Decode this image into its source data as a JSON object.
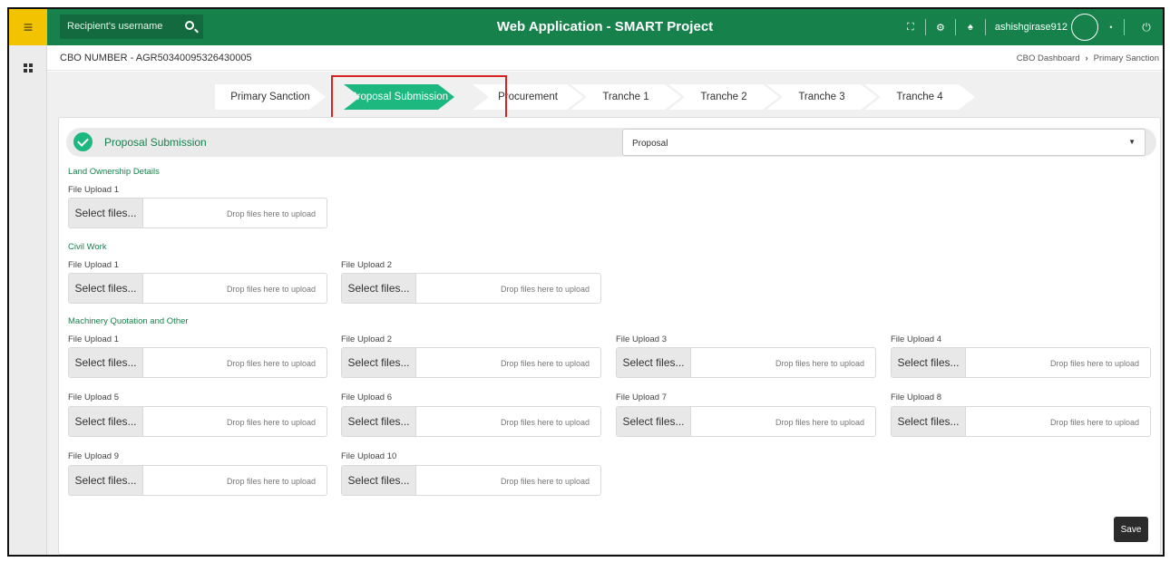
{
  "topbar": {
    "search_placeholder": "Recipient's username",
    "title": "Web Application - SMART Project",
    "username": "ashishgirase912"
  },
  "subheader": {
    "cbo_number": "CBO NUMBER - AGR50340095326430005",
    "breadcrumb": [
      "CBO Dashboard",
      "Primary Sanction"
    ]
  },
  "stepper": {
    "steps": [
      "Primary Sanction",
      "Proposal Submission",
      "Procurement",
      "Tranche 1",
      "Tranche 2",
      "Tranche 3",
      "Tranche 4"
    ],
    "active": "Proposal Submission"
  },
  "section": {
    "title": "Proposal Submission",
    "select_value": "Proposal"
  },
  "groups": {
    "land": "Land Ownership Details",
    "civil": "Civil Work",
    "machinery": "Machinery Quotation and Other"
  },
  "upload": {
    "button": "Select files...",
    "drop": "Drop files here to upload"
  },
  "labels": {
    "u1": "File Upload 1",
    "u2": "File Upload 2",
    "u3": "File Upload 3",
    "u4": "File Upload 4",
    "u5": "File Upload 5",
    "u6": "File Upload 6",
    "u7": "File Upload 7",
    "u8": "File Upload 8",
    "u9": "File Upload 9",
    "u10": "File Upload 10"
  },
  "save_label": "Save",
  "icons": [
    "menu-icon",
    "grid-icon",
    "search-icon",
    "fullscreen-icon",
    "settings-icon",
    "notification-icon",
    "caret-down-icon",
    "power-icon",
    "check-icon"
  ],
  "colors": {
    "brand_green": "#17814c",
    "active_step": "#1db880",
    "menu_yellow": "#f2c300",
    "highlight_red": "#d62222"
  }
}
